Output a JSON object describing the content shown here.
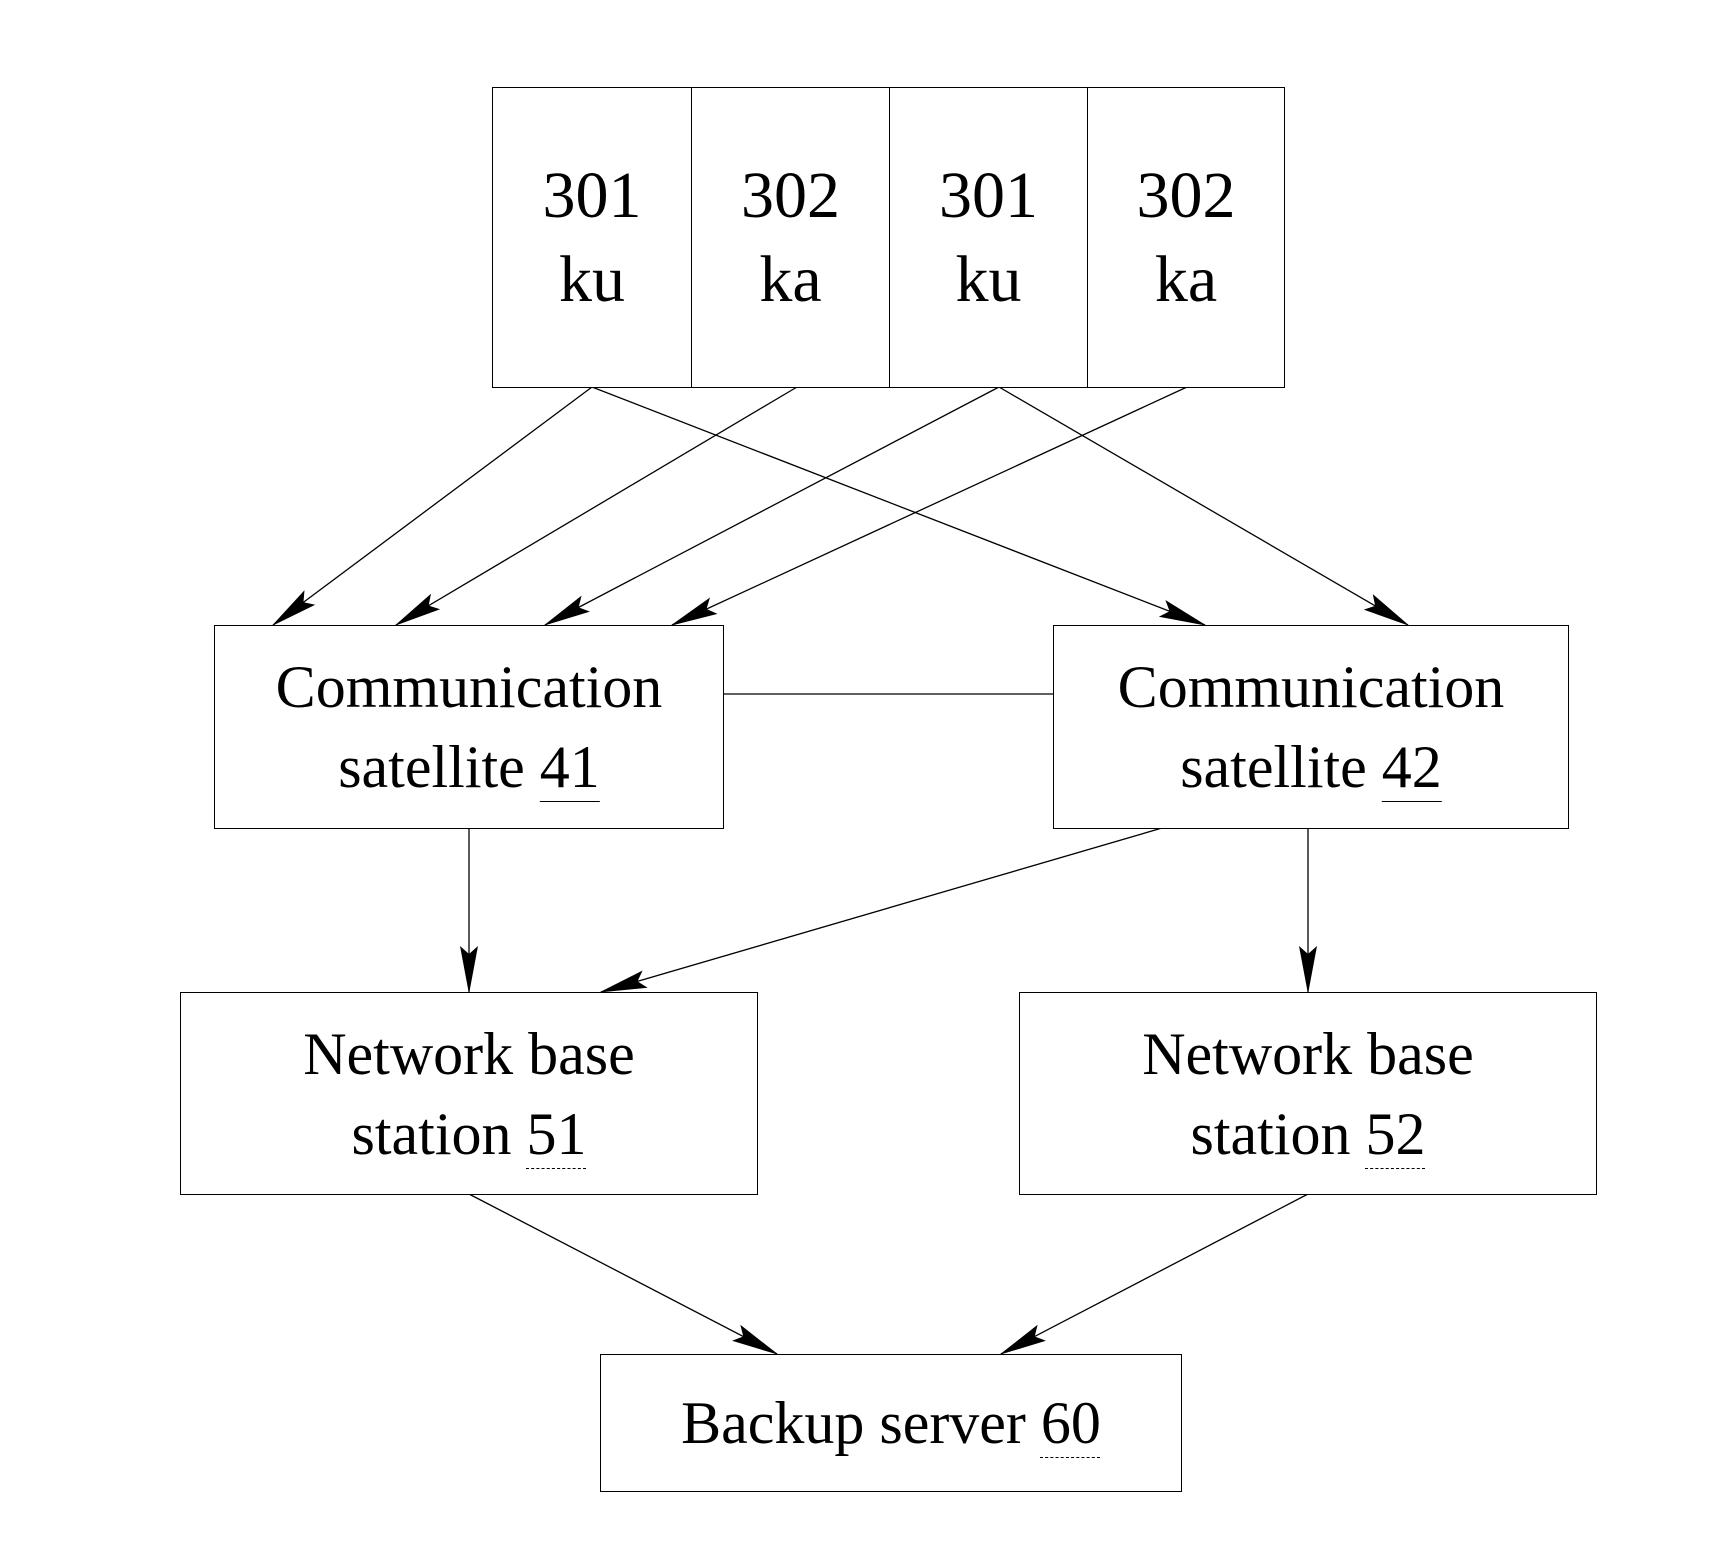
{
  "diagram": {
    "antenna_array": {
      "cells": [
        {
          "id": "cell-1",
          "number": "301",
          "band": "ku"
        },
        {
          "id": "cell-2",
          "number": "302",
          "band": "ka"
        },
        {
          "id": "cell-3",
          "number": "301",
          "band": "ku"
        },
        {
          "id": "cell-4",
          "number": "302",
          "band": "ka"
        }
      ]
    },
    "nodes": {
      "sat41": {
        "line1": "Communication",
        "line2": "satellite",
        "ref": "41"
      },
      "sat42": {
        "line1": "Communication",
        "line2": "satellite",
        "ref": "42"
      },
      "bs51": {
        "line1": "Network base",
        "line2": "station",
        "ref": "51"
      },
      "bs52": {
        "line1": "Network base",
        "line2": "station",
        "ref": "52"
      },
      "server60": {
        "line1": "Backup server",
        "ref": "60"
      }
    },
    "edges": [
      {
        "from": "cell-1",
        "to": "sat41",
        "arrow": true
      },
      {
        "from": "cell-1",
        "to": "sat42",
        "arrow": true
      },
      {
        "from": "cell-2",
        "to": "sat41",
        "arrow": true
      },
      {
        "from": "cell-3",
        "to": "sat41",
        "arrow": true
      },
      {
        "from": "cell-3",
        "to": "sat42",
        "arrow": true
      },
      {
        "from": "cell-4",
        "to": "sat41",
        "arrow": true
      },
      {
        "from": "sat41",
        "to": "sat42",
        "arrow": false
      },
      {
        "from": "sat41",
        "to": "bs51",
        "arrow": true
      },
      {
        "from": "sat42",
        "to": "bs51",
        "arrow": true
      },
      {
        "from": "sat42",
        "to": "bs52",
        "arrow": true
      },
      {
        "from": "bs51",
        "to": "server60",
        "arrow": true
      },
      {
        "from": "bs52",
        "to": "server60",
        "arrow": true
      }
    ]
  }
}
